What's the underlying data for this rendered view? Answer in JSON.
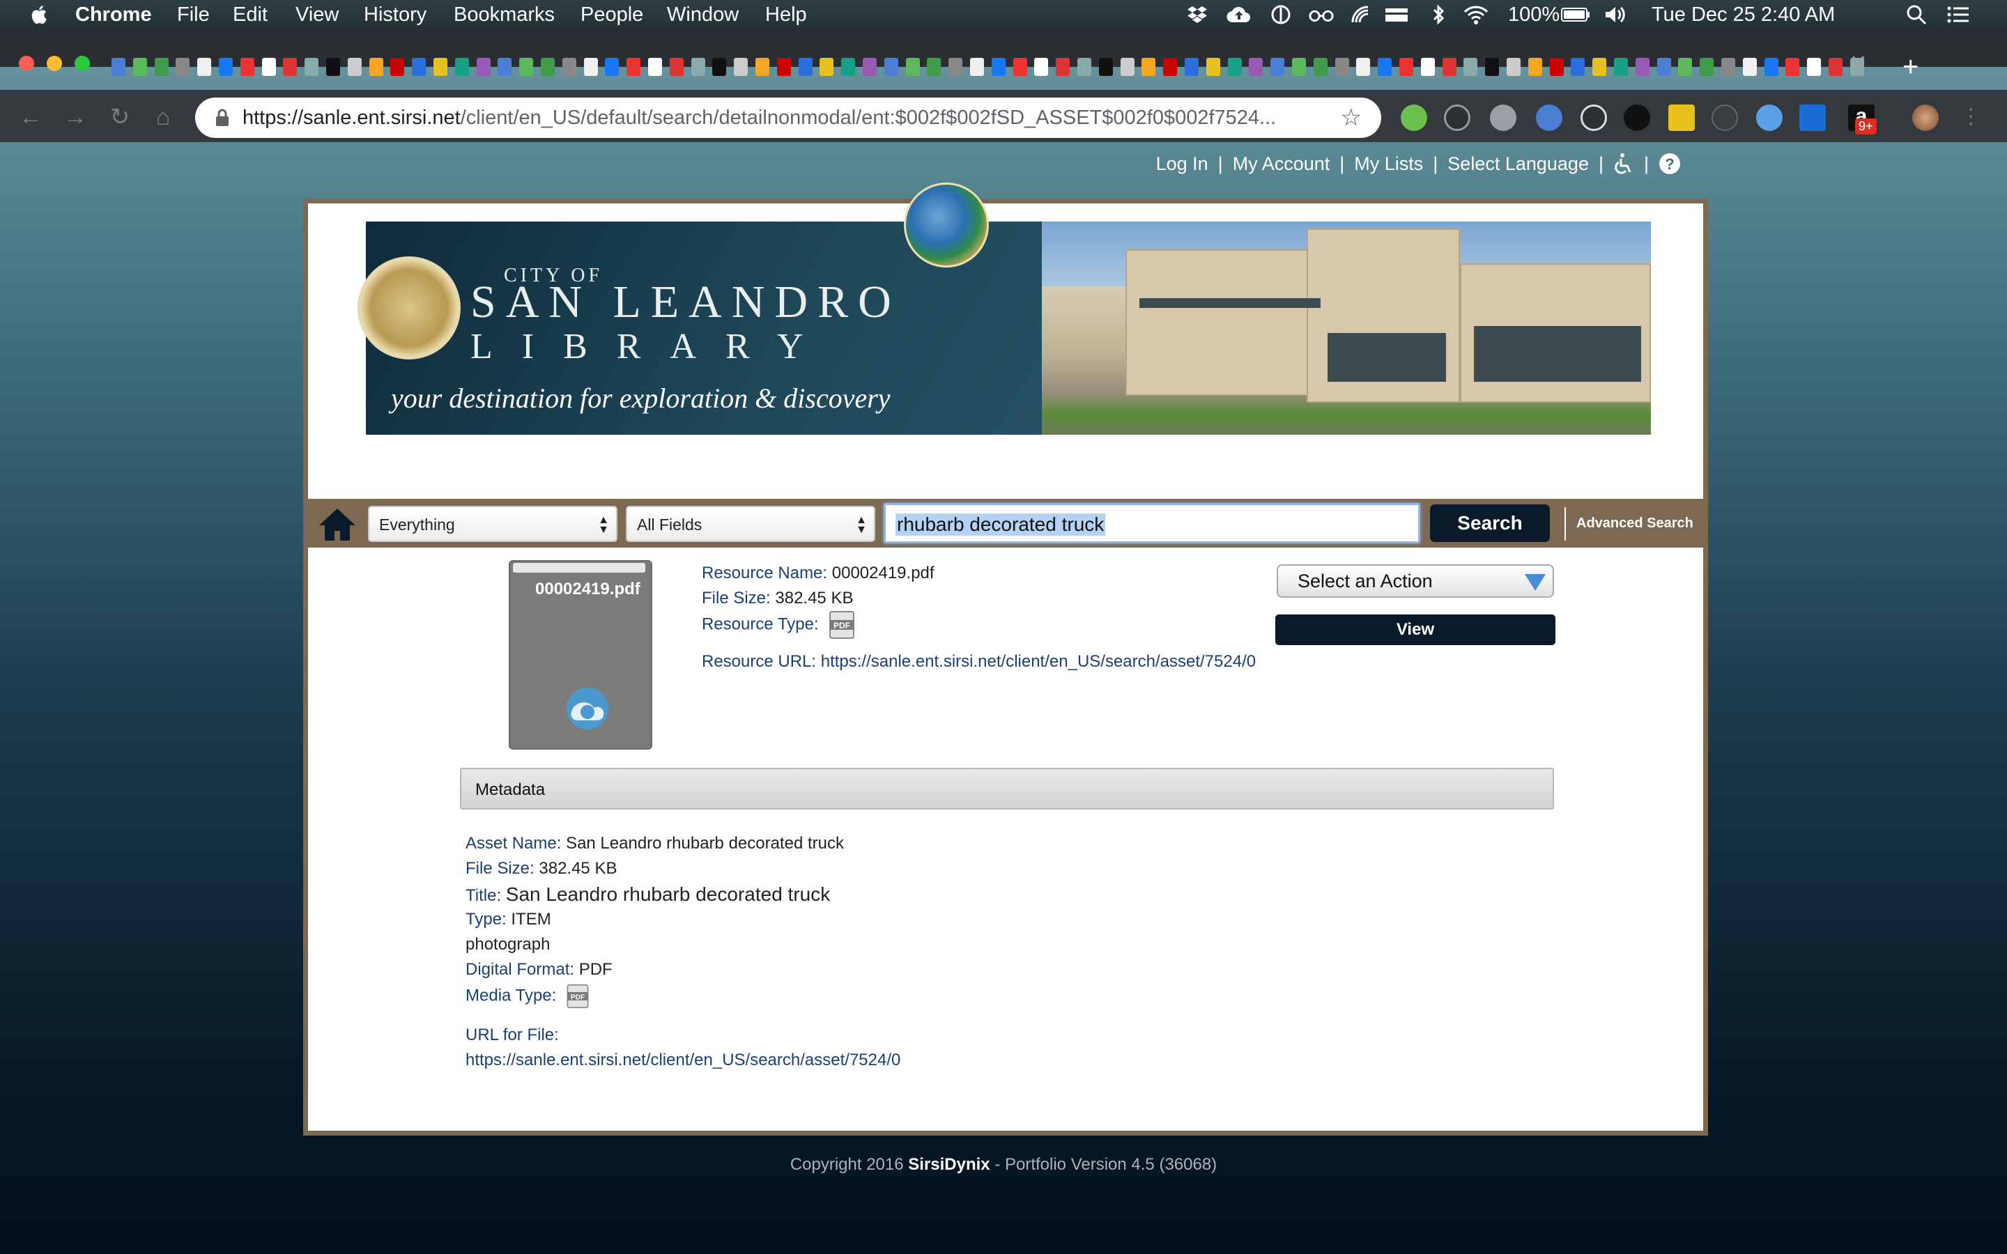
{
  "menubar": {
    "app": "Chrome",
    "items": [
      "File",
      "Edit",
      "View",
      "History",
      "Bookmarks",
      "People",
      "Window",
      "Help"
    ],
    "battery": "100%",
    "clock": "Tue Dec 25  2:40 AM"
  },
  "browser": {
    "url_host": "https://sanle.ent.sirsi.net",
    "url_path": "/client/en_US/default/search/detailnonmodal/ent:$002f$002fSD_ASSET$002f0$002f7524...",
    "badge": "9+"
  },
  "toplinks": {
    "login": "Log In",
    "account": "My Account",
    "lists": "My Lists",
    "language": "Select Language"
  },
  "banner": {
    "city": "CITY OF",
    "name": "SAN LEANDRO",
    "library": "LIBRARY",
    "tagline": "your destination for exploration & discovery"
  },
  "search": {
    "scope": "Everything",
    "field": "All Fields",
    "query": "rhubarb decorated truck",
    "button": "Search",
    "advanced": "Advanced Search"
  },
  "resource": {
    "thumb_label": "00002419.pdf",
    "name_label": "Resource Name:",
    "name": "00002419.pdf",
    "size_label": "File Size:",
    "size": "382.45 KB",
    "type_label": "Resource Type:",
    "url_label": "Resource URL:",
    "url": "https://sanle.ent.sirsi.net/client/en_US/search/asset/7524/0"
  },
  "actions": {
    "select": "Select an Action",
    "view": "View"
  },
  "metadata": {
    "header": "Metadata",
    "asset_label": "Asset Name:",
    "asset": "San Leandro rhubarb decorated truck",
    "size_label": "File Size:",
    "size": "382.45 KB",
    "title_label": "Title:",
    "title": "San Leandro rhubarb decorated truck",
    "type_label": "Type:",
    "type": "ITEM",
    "subtype": "photograph",
    "format_label": "Digital Format:",
    "format": "PDF",
    "media_label": "Media Type:",
    "url_label": "URL for File:",
    "url": "https://sanle.ent.sirsi.net/client/en_US/search/asset/7524/0"
  },
  "footer": {
    "prefix": "Copyright 2016 ",
    "brand": "SirsiDynix",
    "suffix": " - Portfolio Version 4.5 (36068)"
  }
}
